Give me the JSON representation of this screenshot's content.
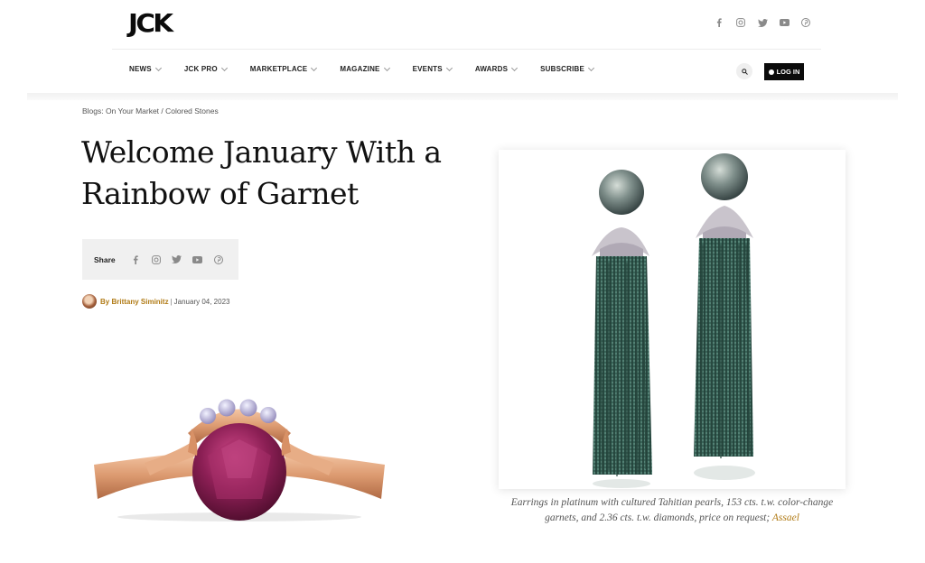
{
  "header": {
    "logo": "JCK",
    "social": [
      "facebook-icon",
      "instagram-icon",
      "twitter-icon",
      "youtube-icon",
      "pinterest-icon"
    ]
  },
  "nav": {
    "items": [
      {
        "label": "NEWS"
      },
      {
        "label": "JCK PRO"
      },
      {
        "label": "MARKETPLACE"
      },
      {
        "label": "MAGAZINE"
      },
      {
        "label": "EVENTS"
      },
      {
        "label": "AWARDS"
      },
      {
        "label": "SUBSCRIBE"
      }
    ],
    "login_label": "LOG IN"
  },
  "article": {
    "breadcrumb": "Blogs: On Your Market / Colored Stones",
    "title": "Welcome January With a Rainbow of Garnet",
    "share_label": "Share",
    "author": "By Brittany Siminitz",
    "separator": "|",
    "date": "January 04, 2023"
  },
  "image": {
    "caption_text": "Earrings in platinum with cultured Tahitian pearls, 153 cts. t.w. color-change garnets, and 2.36 cts. t.w. diamonds, price on request;",
    "caption_link": "Assael"
  },
  "colors": {
    "accent": "#b07a14",
    "login_bg": "#0b0b0b",
    "garnet_green": "#2f5b4f",
    "rhodolite": "#8c1f55"
  }
}
